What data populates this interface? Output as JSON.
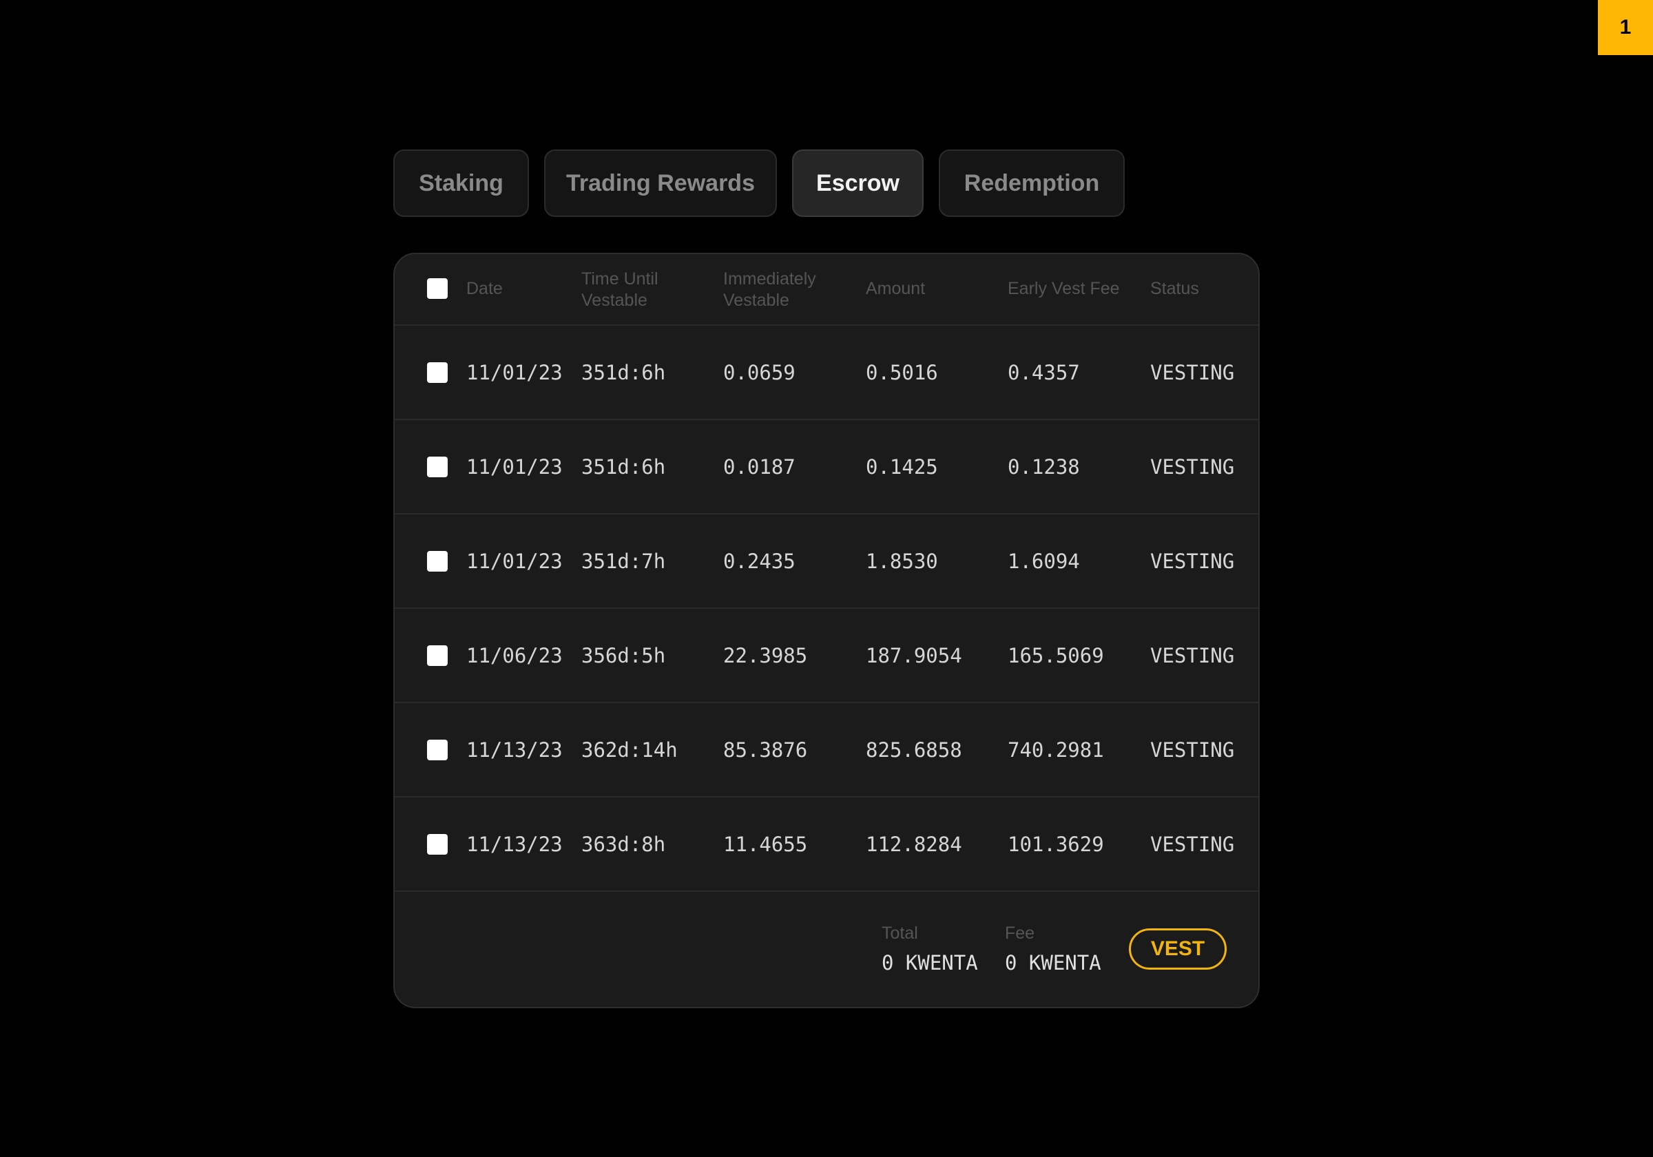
{
  "badge": "1",
  "tabs": [
    {
      "label": "Staking"
    },
    {
      "label": "Trading Rewards"
    },
    {
      "label": "Escrow",
      "active": true
    },
    {
      "label": "Redemption"
    }
  ],
  "table": {
    "headers": {
      "date": "Date",
      "time_until_vestable_1": "Time Until",
      "time_until_vestable_2": "Vestable",
      "immediately_vestable_1": "Immediately",
      "immediately_vestable_2": "Vestable",
      "amount": "Amount",
      "early_vest_fee": "Early Vest Fee",
      "status": "Status"
    },
    "rows": [
      {
        "date": "11/01/23",
        "time": "351d:6h",
        "immediately": "0.0659",
        "amount": "0.5016",
        "fee": "0.4357",
        "status": "VESTING"
      },
      {
        "date": "11/01/23",
        "time": "351d:6h",
        "immediately": "0.0187",
        "amount": "0.1425",
        "fee": "0.1238",
        "status": "VESTING"
      },
      {
        "date": "11/01/23",
        "time": "351d:7h",
        "immediately": "0.2435",
        "amount": "1.8530",
        "fee": "1.6094",
        "status": "VESTING"
      },
      {
        "date": "11/06/23",
        "time": "356d:5h",
        "immediately": "22.3985",
        "amount": "187.9054",
        "fee": "165.5069",
        "status": "VESTING"
      },
      {
        "date": "11/13/23",
        "time": "362d:14h",
        "immediately": "85.3876",
        "amount": "825.6858",
        "fee": "740.2981",
        "status": "VESTING"
      },
      {
        "date": "11/13/23",
        "time": "363d:8h",
        "immediately": "11.4655",
        "amount": "112.8284",
        "fee": "101.3629",
        "status": "VESTING"
      }
    ]
  },
  "footer": {
    "total_label": "Total",
    "total_value": "0 KWENTA",
    "fee_label": "Fee",
    "fee_value": "0 KWENTA",
    "vest_label": "VEST"
  },
  "colors": {
    "accent": "#f1b50c",
    "badge": "#fdb704",
    "background": "#000000",
    "card": "#1b1b1b"
  }
}
